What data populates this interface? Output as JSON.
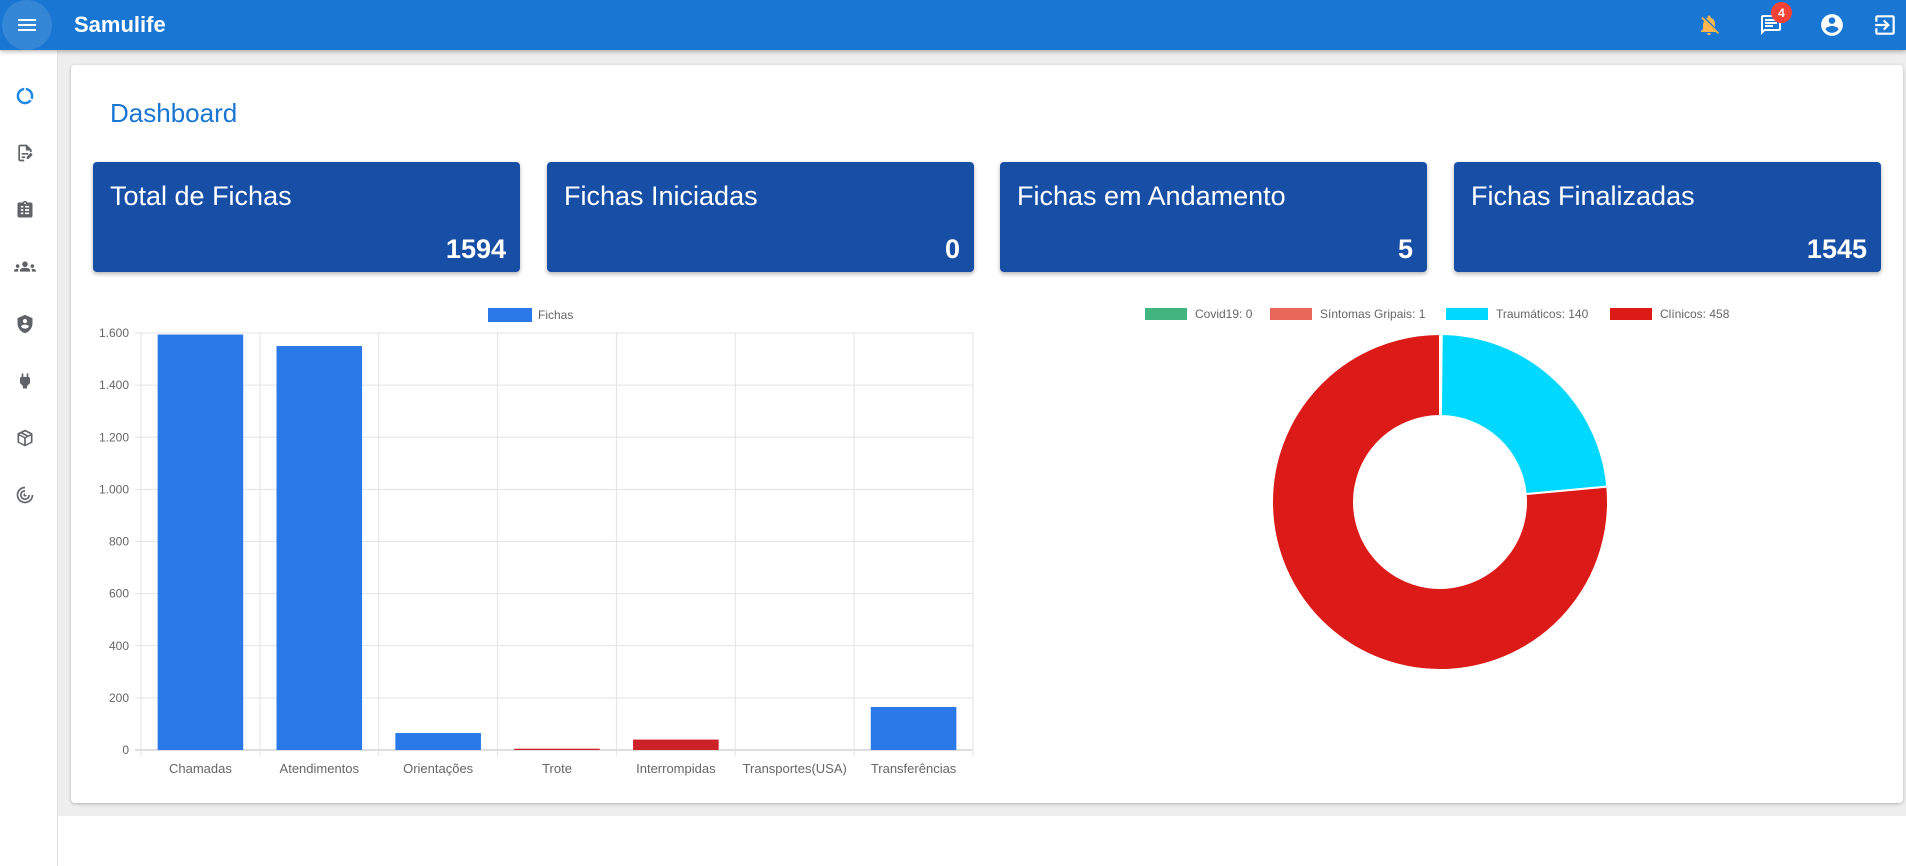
{
  "app": {
    "title": "Samulife"
  },
  "topbar": {
    "notifications_count": "4"
  },
  "page": {
    "title": "Dashboard"
  },
  "stats": [
    {
      "label": "Total de Fichas",
      "value": "1594"
    },
    {
      "label": "Fichas Iniciadas",
      "value": "0"
    },
    {
      "label": "Fichas em Andamento",
      "value": "5"
    },
    {
      "label": "Fichas Finalizadas",
      "value": "1545"
    }
  ],
  "colors": {
    "topbar": "#1976d2",
    "stat_card": "#174ea6",
    "bar_blue": "#2b78e8",
    "bar_red": "#cc2127"
  },
  "chart_data": [
    {
      "type": "bar",
      "legend_position": "top",
      "grid": true,
      "ylim": [
        0,
        1600
      ],
      "yticks": [
        "0",
        "200",
        "400",
        "600",
        "800",
        "1.000",
        "1.200",
        "1.400",
        "1.600"
      ],
      "categories": [
        "Chamadas",
        "Atendimentos",
        "Orientações",
        "Trote",
        "Interrompidas",
        "Transportes(USA)",
        "Transferências"
      ],
      "series": [
        {
          "name": "Fichas",
          "values": [
            1594,
            1550,
            65,
            5,
            40,
            0,
            165
          ],
          "colors": [
            "#2b78e8",
            "#2b78e8",
            "#2b78e8",
            "#cc2127",
            "#cc2127",
            "#2b78e8",
            "#2b78e8"
          ]
        }
      ]
    },
    {
      "type": "pie",
      "donut": true,
      "legend_position": "top",
      "slices": [
        {
          "label": "Covid19: 0",
          "value": 0,
          "color": "#43b581"
        },
        {
          "label": "Síntomas Gripais: 1",
          "value": 1,
          "color": "#e8675a"
        },
        {
          "label": "Traumáticos: 140",
          "value": 140,
          "color": "#00d8ff"
        },
        {
          "label": "Clínicos: 458",
          "value": 458,
          "color": "#dc1a17"
        }
      ]
    }
  ]
}
